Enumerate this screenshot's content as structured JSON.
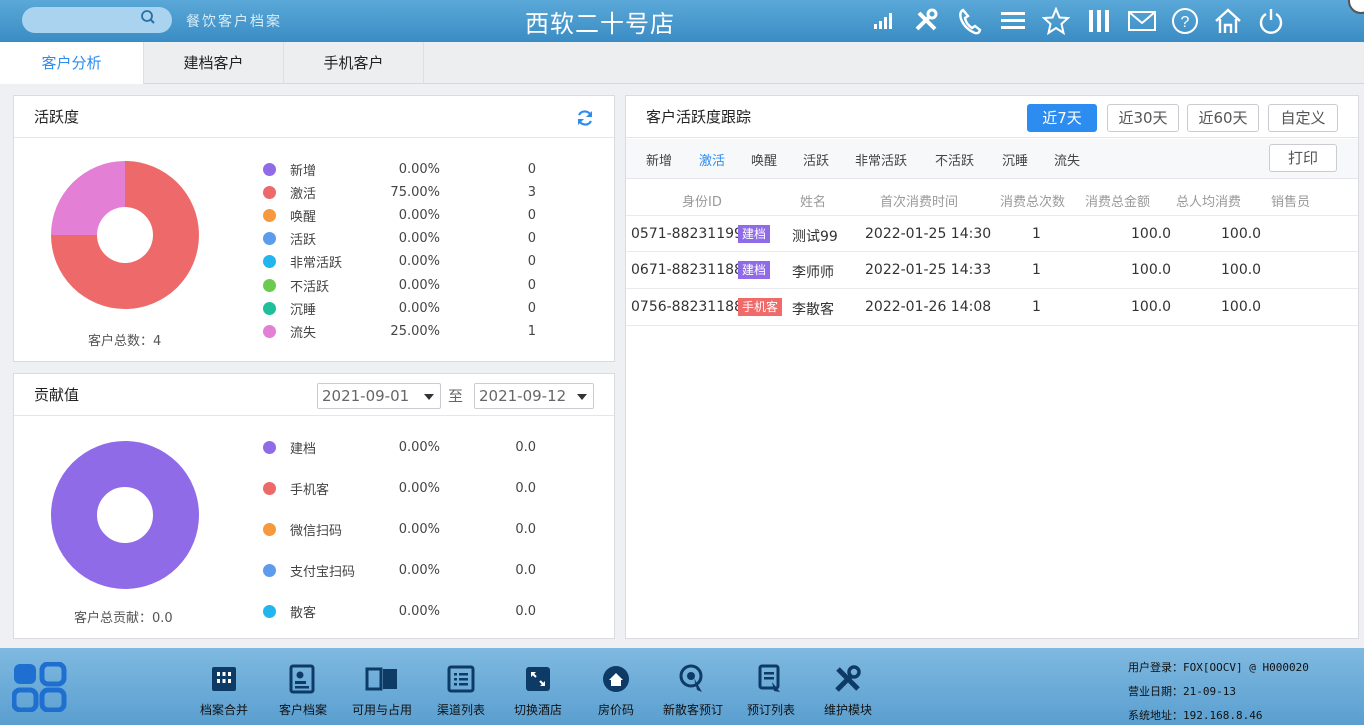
{
  "header": {
    "app_name": "餐饮客户档案",
    "store_title": "西软二十号店",
    "search_placeholder": "",
    "icons": [
      "signal-icon",
      "tools-icon",
      "phone-icon",
      "menu-icon",
      "star-icon",
      "columns-icon",
      "mail-icon",
      "help-icon",
      "home-icon",
      "power-icon"
    ]
  },
  "tabs": [
    {
      "label": "客户分析",
      "active": true
    },
    {
      "label": "建档客户",
      "active": false
    },
    {
      "label": "手机客户",
      "active": false
    }
  ],
  "activity": {
    "title": "活跃度",
    "total_label": "客户总数：4",
    "legend": [
      {
        "name": "新增",
        "pct": "0.00%",
        "count": "0",
        "color": "#8f6be8"
      },
      {
        "name": "激活",
        "pct": "75.00%",
        "count": "3",
        "color": "#ee6a6a"
      },
      {
        "name": "唤醒",
        "pct": "0.00%",
        "count": "0",
        "color": "#f5993c"
      },
      {
        "name": "活跃",
        "pct": "0.00%",
        "count": "0",
        "color": "#5d9cec"
      },
      {
        "name": "非常活跃",
        "pct": "0.00%",
        "count": "0",
        "color": "#22b5ee"
      },
      {
        "name": "不活跃",
        "pct": "0.00%",
        "count": "0",
        "color": "#6ccb4e"
      },
      {
        "name": "沉睡",
        "pct": "0.00%",
        "count": "0",
        "color": "#1fbf9c"
      },
      {
        "name": "流失",
        "pct": "25.00%",
        "count": "1",
        "color": "#e47fd6"
      }
    ]
  },
  "contribution": {
    "title": "贡献值",
    "date_from": "2021-09-01",
    "date_sep": "至",
    "date_to": "2021-09-12",
    "total_label": "客户总贡献：0.0",
    "legend": [
      {
        "name": "建档",
        "pct": "0.00%",
        "value": "0.0",
        "color": "#8f6be8"
      },
      {
        "name": "手机客",
        "pct": "0.00%",
        "value": "0.0",
        "color": "#ee6a6a"
      },
      {
        "name": "微信扫码",
        "pct": "0.00%",
        "value": "0.0",
        "color": "#f5993c"
      },
      {
        "name": "支付宝扫码",
        "pct": "0.00%",
        "value": "0.0",
        "color": "#5d9cec"
      },
      {
        "name": "散客",
        "pct": "0.00%",
        "value": "0.0",
        "color": "#22b5ee"
      }
    ]
  },
  "tracking": {
    "title": "客户活跃度跟踪",
    "ranges": [
      {
        "label": "近7天",
        "active": true
      },
      {
        "label": "近30天",
        "active": false
      },
      {
        "label": "近60天",
        "active": false
      },
      {
        "label": "自定义",
        "active": false
      }
    ],
    "filters": [
      {
        "label": "新增",
        "active": false
      },
      {
        "label": "激活",
        "active": true
      },
      {
        "label": "唤醒",
        "active": false
      },
      {
        "label": "活跃",
        "active": false
      },
      {
        "label": "非常活跃",
        "active": false
      },
      {
        "label": "不活跃",
        "active": false
      },
      {
        "label": "沉睡",
        "active": false
      },
      {
        "label": "流失",
        "active": false
      }
    ],
    "print_label": "打印",
    "columns": [
      "身份ID",
      "姓名",
      "首次消费时间",
      "消费总次数",
      "消费总金额",
      "总人均消费",
      "销售员"
    ],
    "rows": [
      {
        "id": "0571-88231199",
        "tag": "建档",
        "tag_type": "file",
        "name": "测试99",
        "first_time": "2022-01-25 14:30",
        "count": "1",
        "amount": "100.0",
        "avg": "100.0",
        "sales": ""
      },
      {
        "id": "0671-88231188",
        "tag": "建档",
        "tag_type": "file",
        "name": "李师师",
        "first_time": "2022-01-25 14:33",
        "count": "1",
        "amount": "100.0",
        "avg": "100.0",
        "sales": ""
      },
      {
        "id": "0756-88231188",
        "tag": "手机客",
        "tag_type": "mobile",
        "name": "李散客",
        "first_time": "2022-01-26 14:08",
        "count": "1",
        "amount": "100.0",
        "avg": "100.0",
        "sales": ""
      }
    ]
  },
  "bottom": {
    "tools": [
      {
        "label": "档案合并",
        "icon": "archive-merge-icon"
      },
      {
        "label": "客户档案",
        "icon": "customer-file-icon"
      },
      {
        "label": "可用与占用",
        "icon": "availability-icon"
      },
      {
        "label": "渠道列表",
        "icon": "channel-list-icon"
      },
      {
        "label": "切换酒店",
        "icon": "switch-hotel-icon"
      },
      {
        "label": "房价码",
        "icon": "rate-code-icon"
      },
      {
        "label": "新散客预订",
        "icon": "new-booking-icon"
      },
      {
        "label": "预订列表",
        "icon": "booking-list-icon"
      },
      {
        "label": "维护模块",
        "icon": "maintenance-icon"
      }
    ],
    "sysinfo": {
      "user_label": "用户登录：",
      "user_value": "FOX[OOCV] @ H000020",
      "date_label": "营业日期：",
      "date_value": "21-09-13",
      "addr_label": "系统地址：",
      "addr_value": "192.168.8.46"
    }
  }
}
